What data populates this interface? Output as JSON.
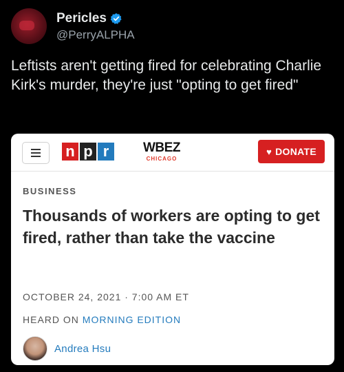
{
  "tweet": {
    "display_name": "Pericles",
    "handle": "@PerryALPHA",
    "verified": true,
    "verified_color": "#1d9bf0",
    "text": "Leftists aren't getting fired for celebrating Charlie Kirk's murder, they're just \"opting to get fired\""
  },
  "article_card": {
    "menu_icon": "hamburger-icon",
    "logo_letters": [
      "n",
      "p",
      "r"
    ],
    "logo_colors": [
      "#d62021",
      "#222222",
      "#237bbd"
    ],
    "station_name": "WBEZ",
    "station_city": "CHICAGO",
    "donate_label": "DONATE",
    "donate_icon": "heart-icon",
    "donate_color": "#d62021",
    "section": "BUSINESS",
    "headline": "Thousands of workers are opting to get fired, rather than take the vaccine",
    "dateline": "OCTOBER 24, 2021 · 7:00 AM ET",
    "heard_on_prefix": "HEARD ON",
    "heard_on_show": "MORNING EDITION",
    "author": "Andrea Hsu"
  }
}
